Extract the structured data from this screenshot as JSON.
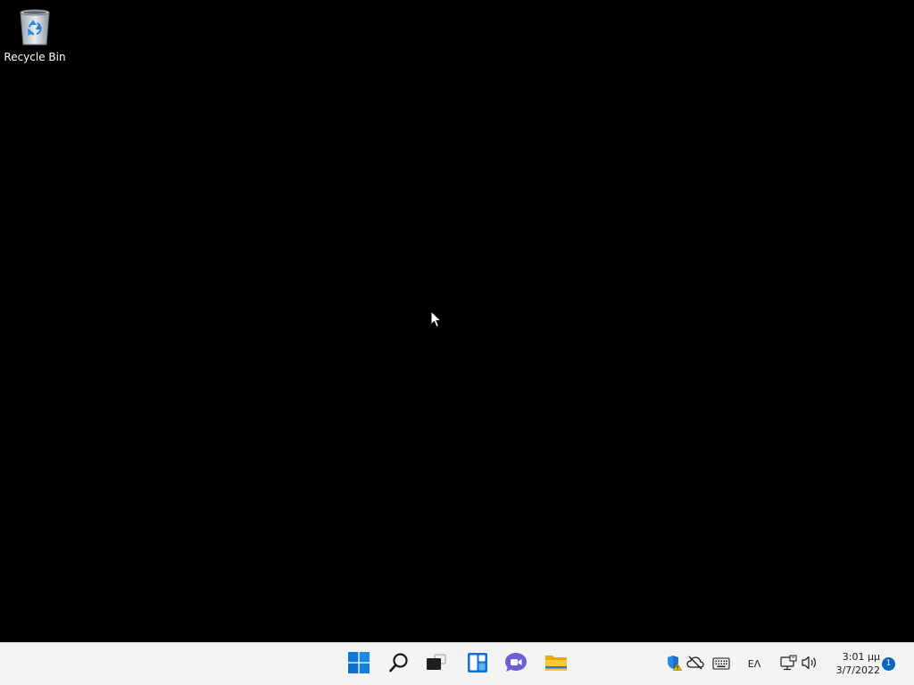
{
  "desktop": {
    "background_color": "#000000",
    "icons": [
      {
        "label": "Recycle Bin",
        "icon": "recycle-bin-icon"
      }
    ]
  },
  "taskbar": {
    "background_color": "#f3f3f3",
    "apps": [
      {
        "name": "Start",
        "icon": "windows-start-icon"
      },
      {
        "name": "Search",
        "icon": "search-icon"
      },
      {
        "name": "Task View",
        "icon": "task-view-icon"
      },
      {
        "name": "Widgets",
        "icon": "widgets-icon"
      },
      {
        "name": "Chat",
        "icon": "chat-icon"
      },
      {
        "name": "File Explorer",
        "icon": "file-explorer-icon"
      }
    ],
    "tray": {
      "icons": [
        "security-shield-icon",
        "onedrive-offline-icon",
        "touch-keyboard-icon",
        "network-icon",
        "volume-icon"
      ],
      "language": "ΕΛ",
      "time": "3:01 μμ",
      "date": "3/7/2022",
      "notification_count": "1"
    }
  }
}
